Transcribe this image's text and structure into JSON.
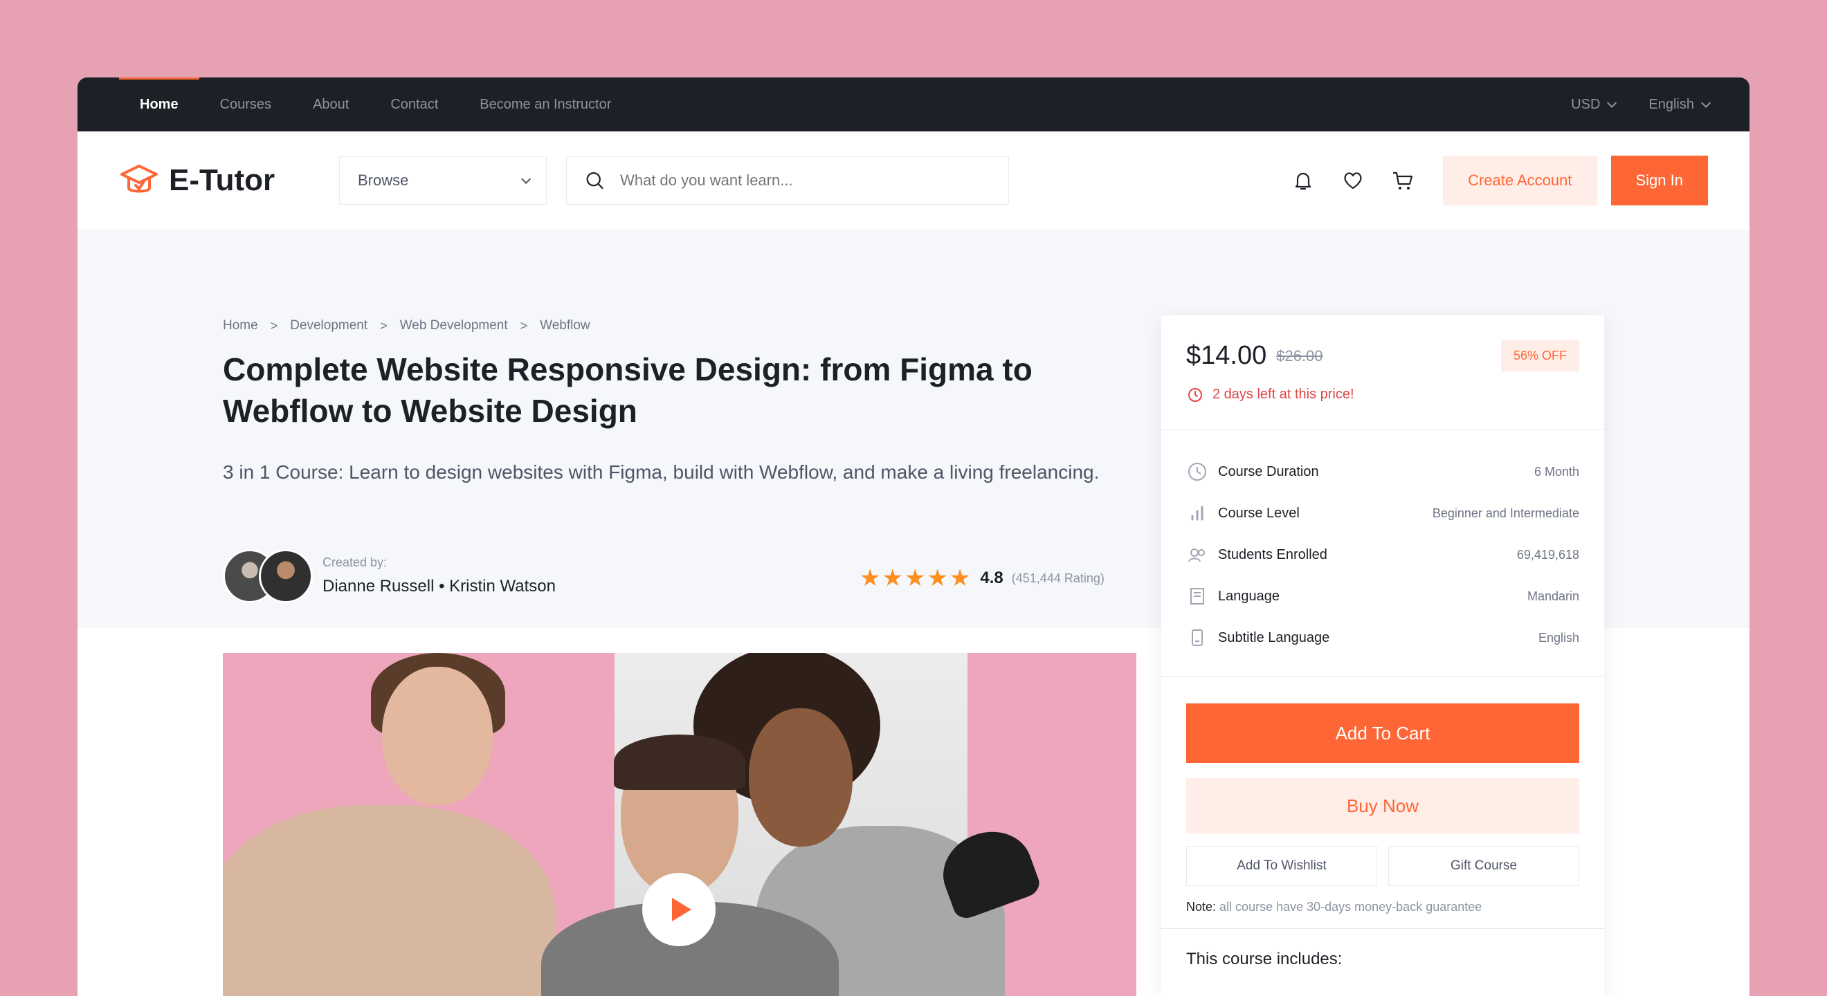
{
  "topnav": {
    "items": [
      "Home",
      "Courses",
      "About",
      "Contact",
      "Become an Instructor"
    ],
    "active": "Home",
    "currency": "USD",
    "language": "English"
  },
  "header": {
    "brand": "E-Tutor",
    "browse_label": "Browse",
    "search_placeholder": "What do you want learn...",
    "create_account": "Create Account",
    "sign_in": "Sign In"
  },
  "breadcrumb": [
    "Home",
    "Development",
    "Web Development",
    "Webflow"
  ],
  "course": {
    "title": "Complete Website Responsive Design: from Figma to Webflow to Website Design",
    "subtitle": "3 in 1 Course: Learn to design websites with Figma, build with Webflow, and make a living freelancing.",
    "created_by_label": "Created by:",
    "instructors": "Dianne Russell • Kristin Watson",
    "rating": "4.8",
    "rating_count": "(451,444 Rating)"
  },
  "card": {
    "price": "$14.00",
    "old_price": "$26.00",
    "discount": "56% OFF",
    "deadline": "2 days left at this price!",
    "info": [
      {
        "icon": "clock-icon",
        "key": "Course Duration",
        "value": "6 Month"
      },
      {
        "icon": "bar-chart-icon",
        "key": "Course Level",
        "value": "Beginner and Intermediate"
      },
      {
        "icon": "users-icon",
        "key": "Students Enrolled",
        "value": "69,419,618"
      },
      {
        "icon": "notebook-icon",
        "key": "Language",
        "value": "Mandarin"
      },
      {
        "icon": "notepad-icon",
        "key": "Subtitle Language",
        "value": "English"
      }
    ],
    "add_to_cart": "Add To Cart",
    "buy_now": "Buy Now",
    "add_to_wishlist": "Add To Wishlist",
    "gift_course": "Gift Course",
    "note_label": "Note:",
    "note_text": "all course have 30-days money-back guarantee",
    "includes": "This course includes:"
  },
  "colors": {
    "accent": "#ff6636",
    "accent_light": "#ffeee8",
    "dark": "#1d2026",
    "star": "#fd8e1f",
    "background": "#e6a1b3"
  }
}
